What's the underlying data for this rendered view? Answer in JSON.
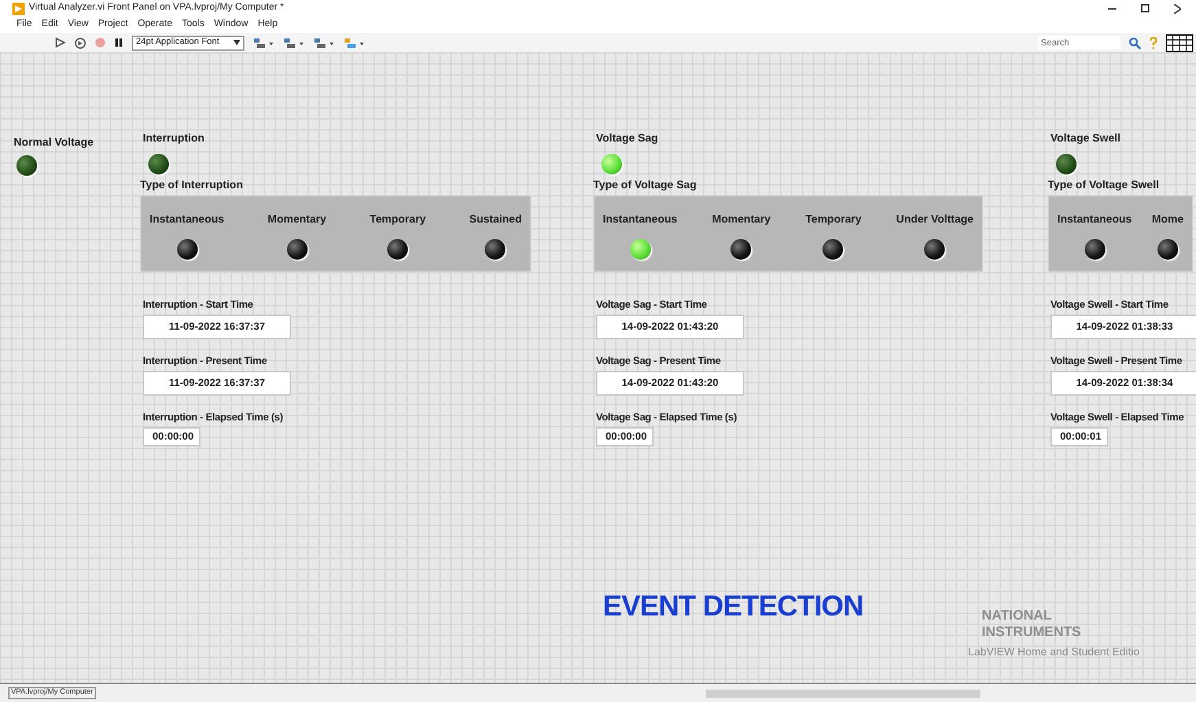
{
  "window": {
    "title": "Virtual Analyzer.vi Front Panel on VPA.lvproj/My Computer *"
  },
  "menu": [
    "File",
    "Edit",
    "View",
    "Project",
    "Operate",
    "Tools",
    "Window",
    "Help"
  ],
  "toolbar": {
    "font": "24pt Application Font",
    "search": {
      "placeholder": "Search"
    }
  },
  "normal_voltage": {
    "label": "Normal Voltage",
    "on": false
  },
  "events": [
    {
      "label": "Interruption",
      "on": false,
      "type_label": "Type of Interruption",
      "types": [
        {
          "label": "Instantaneous",
          "on": false
        },
        {
          "label": "Momentary",
          "on": false
        },
        {
          "label": "Temporary",
          "on": false
        },
        {
          "label": "Sustained",
          "on": false
        }
      ],
      "fields": [
        {
          "label": "Interruption - Start Time",
          "value": "11-09-2022 16:37:37"
        },
        {
          "label": "Interruption - Present Time",
          "value": "11-09-2022 16:37:37"
        },
        {
          "label": "Interruption - Elapsed Time (s)",
          "value": "00:00:00",
          "kind": "short"
        }
      ]
    },
    {
      "label": "Voltage Sag",
      "on": true,
      "type_label": "Type of Voltage Sag",
      "types": [
        {
          "label": "Instantaneous",
          "on": true
        },
        {
          "label": "Momentary",
          "on": false
        },
        {
          "label": "Temporary",
          "on": false
        },
        {
          "label": "Under Volttage",
          "on": false
        }
      ],
      "fields": [
        {
          "label": "Voltage Sag - Start Time",
          "value": "14-09-2022 01:43:20"
        },
        {
          "label": "Voltage Sag - Present Time",
          "value": "14-09-2022 01:43:20"
        },
        {
          "label": "Voltage Sag - Elapsed Time (s)",
          "value": "00:00:00",
          "kind": "short"
        }
      ]
    },
    {
      "label": "Voltage Swell",
      "on": false,
      "type_label": "Type of Voltage Swell",
      "types": [
        {
          "label": "Instantaneous",
          "on": false
        },
        {
          "label": "Mome",
          "on": false
        }
      ],
      "fields": [
        {
          "label": "Voltage Swell - Start Time",
          "value": "14-09-2022 01:38:33"
        },
        {
          "label": "Voltage Swell - Present Time",
          "value": "14-09-2022 01:38:34"
        },
        {
          "label": "Voltage Swell - Elapsed Time",
          "value": "00:00:01",
          "kind": "short"
        }
      ]
    }
  ],
  "heading": "EVENT DETECTION",
  "branding": {
    "logo": "NATIONAL INSTRUMENTS",
    "edition": "LabVIEW Home and Student Editio"
  },
  "status_bar": {
    "project": "VPA.lvproj/My Computer"
  }
}
